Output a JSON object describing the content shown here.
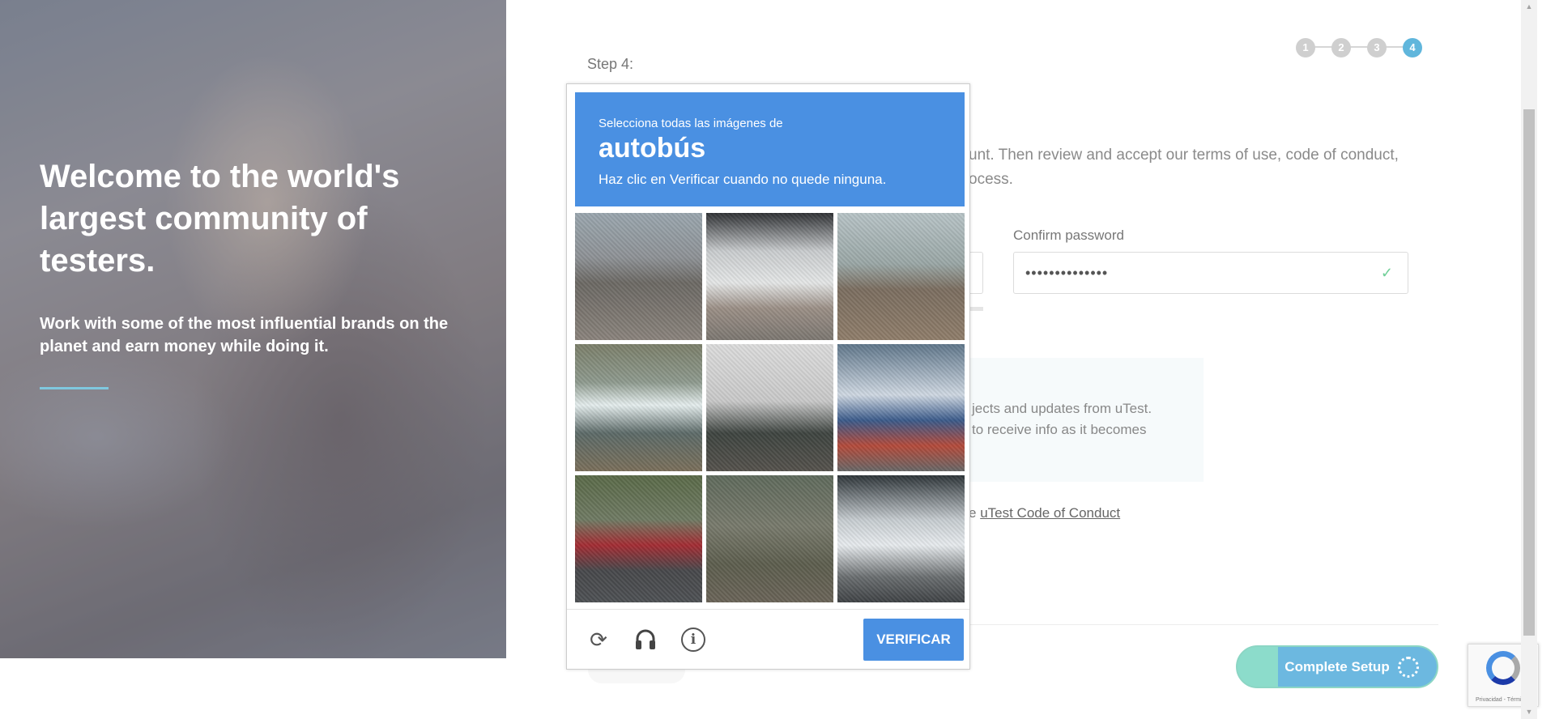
{
  "hero": {
    "title": "Welcome to the world's largest community of testers.",
    "subtitle": "Work with some of the most influential brands on the planet and earn money while doing it."
  },
  "form": {
    "step_label": "Step 4:",
    "steps": [
      "1",
      "2",
      "3",
      "4"
    ],
    "active_step": "4",
    "intro_partial": "unt. Then review and accept our terms of use, code of conduct,\nocess.",
    "confirm_password_label": "Confirm password",
    "confirm_password_value": "••••••••••••••",
    "info_partial": "jects and updates from uTest.\nto receive info as it becomes",
    "conduct_prefix": "e ",
    "conduct_link": "uTest Code of Conduct",
    "complete_button": "Complete Setup"
  },
  "captcha": {
    "line1": "Selecciona todas las imágenes de",
    "keyword": "autobús",
    "line2": "Haz clic en Verificar cuando no quede ninguna.",
    "verify_button": "VERIFICAR",
    "footer_icons": [
      "reload-icon",
      "audio-icon",
      "info-icon"
    ]
  },
  "recaptcha_badge": {
    "text": "Privacidad - Términos"
  },
  "colors": {
    "accent_blue": "#4a90e2",
    "step_active": "#60b6dc",
    "check_green": "#6fcf97"
  }
}
